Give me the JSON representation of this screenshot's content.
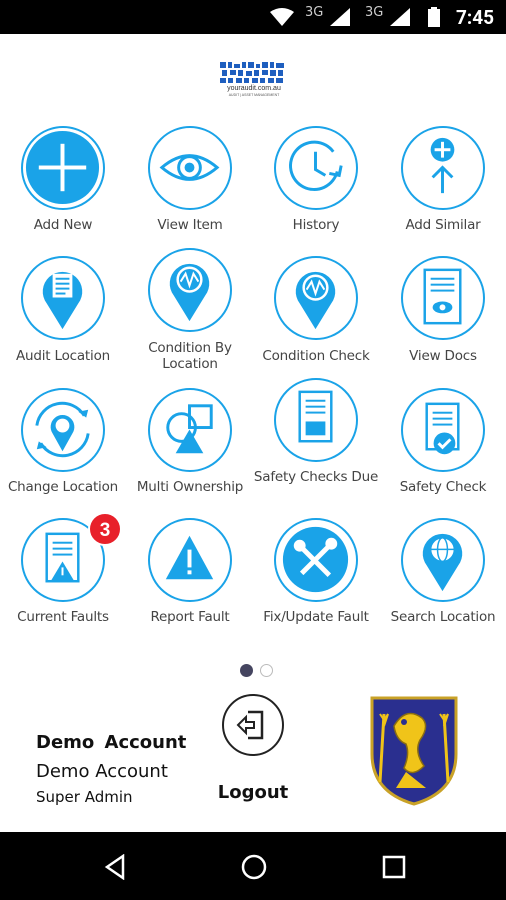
{
  "status_bar": {
    "time": "7:45",
    "network1": "3G",
    "network2": "3G"
  },
  "logo": {
    "text": "youraudit.com.au",
    "tagline": "AUDIT | ASSET MANAGEMENT"
  },
  "tiles": [
    {
      "label": "Add New",
      "icon": "add-icon"
    },
    {
      "label": "View Item",
      "icon": "eye-icon"
    },
    {
      "label": "History",
      "icon": "history-clock-icon"
    },
    {
      "label": "Add Similar",
      "icon": "add-similar-icon"
    },
    {
      "label": "Audit Location",
      "icon": "audit-location-pin-icon"
    },
    {
      "label": "Condition By Location",
      "icon": "condition-location-pin-icon"
    },
    {
      "label": "Condition Check",
      "icon": "condition-check-pin-icon"
    },
    {
      "label": "View Docs",
      "icon": "documents-icon"
    },
    {
      "label": "Change Location",
      "icon": "change-location-icon"
    },
    {
      "label": "Multi Ownership",
      "icon": "shapes-icon"
    },
    {
      "label": "Safety Checks Due",
      "icon": "calendar-checklist-icon"
    },
    {
      "label": "Safety Check",
      "icon": "checked-document-icon"
    },
    {
      "label": "Current Faults",
      "icon": "warning-document-icon",
      "badge": "3"
    },
    {
      "label": "Report Fault",
      "icon": "warning-triangle-icon"
    },
    {
      "label": "Fix/Update Fault",
      "icon": "tools-icon"
    },
    {
      "label": "Search Location",
      "icon": "globe-pin-icon"
    }
  ],
  "pager": {
    "pages": 2,
    "current": 1
  },
  "account": {
    "display_name": "Demo  Account",
    "full_name": "Demo Account",
    "role": "Super Admin"
  },
  "logout": {
    "label": "Logout"
  },
  "colors": {
    "accent": "#1aa3e8",
    "badge": "#e8202a",
    "crest_blue": "#2a2f8f",
    "crest_gold": "#f0c419"
  }
}
